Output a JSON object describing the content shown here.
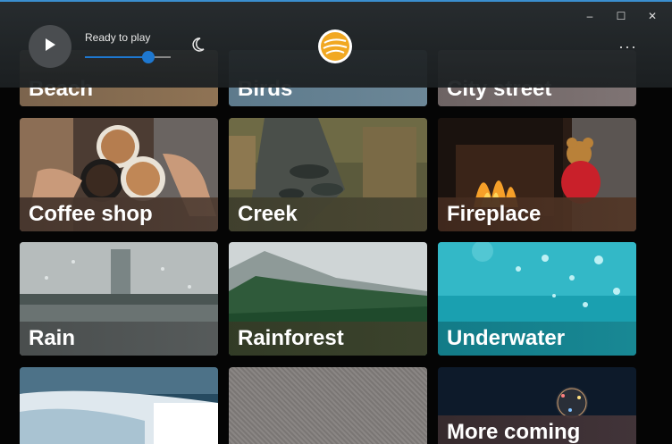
{
  "player": {
    "status": "Ready to play",
    "volume_fraction": 0.74
  },
  "icons": {
    "play": "play-icon",
    "moon": "moon-icon",
    "logo": "app-logo-icon",
    "more": "more-icon"
  },
  "window_controls": {
    "minimize": "–",
    "maximize": "☐",
    "close": "✕"
  },
  "more_label": "···",
  "tiles": [
    {
      "label": "Beach"
    },
    {
      "label": "Birds"
    },
    {
      "label": "City street"
    },
    {
      "label": "Coffee shop"
    },
    {
      "label": "Creek"
    },
    {
      "label": "Fireplace"
    },
    {
      "label": "Rain"
    },
    {
      "label": "Rainforest"
    },
    {
      "label": "Underwater"
    },
    {
      "label": ""
    },
    {
      "label": ""
    },
    {
      "label": "More coming"
    }
  ],
  "colors": {
    "accent": "#1e78d0",
    "topbar": "#2b2f31",
    "logo": "#f1a822"
  }
}
